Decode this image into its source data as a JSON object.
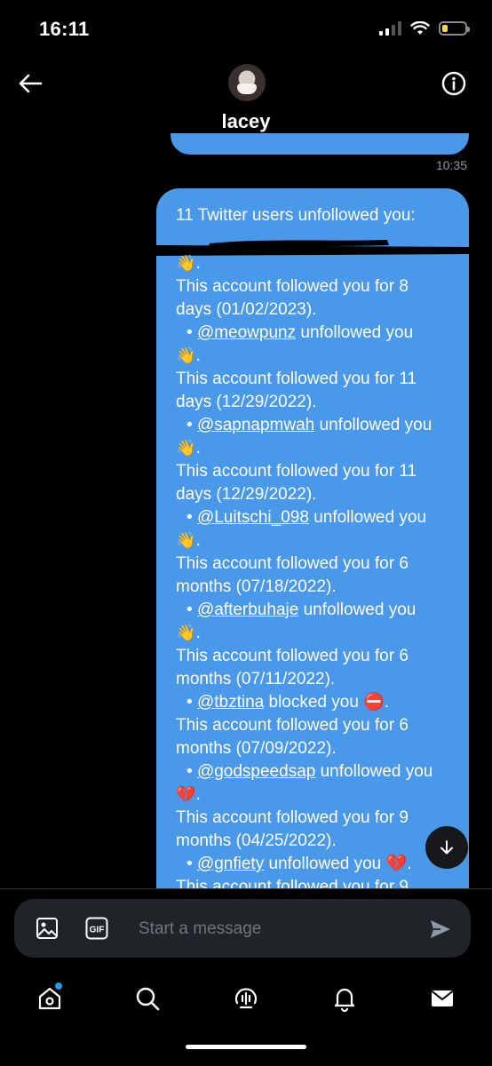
{
  "status": {
    "time": "16:11",
    "battery_level": 0.25,
    "battery_color": "#f7d74a"
  },
  "header": {
    "contact_name": "lacey",
    "back_icon": "arrow-left-icon",
    "info_icon": "info-icon"
  },
  "thread": {
    "previous_timestamp": "10:35",
    "bubble_color": "#4a98e9",
    "message": {
      "heading": "11 Twitter users unfollowed you:",
      "lines": [
        {
          "type": "emoji",
          "text": "👋."
        },
        {
          "type": "text",
          "text": "This account followed you for 8"
        },
        {
          "type": "text",
          "text": "days (01/02/2023)."
        },
        {
          "type": "entry",
          "bullet": "•",
          "handle": "@meowpunz",
          "action": " unfollowed you"
        },
        {
          "type": "emoji",
          "text": "👋."
        },
        {
          "type": "text",
          "text": "This account followed you for 11"
        },
        {
          "type": "text",
          "text": "days (12/29/2022)."
        },
        {
          "type": "entry",
          "bullet": "•",
          "handle": "@sapnapmwah",
          "action": " unfollowed you"
        },
        {
          "type": "emoji",
          "text": "👋."
        },
        {
          "type": "text",
          "text": "This account followed you for 11"
        },
        {
          "type": "text",
          "text": "days (12/29/2022)."
        },
        {
          "type": "entry",
          "bullet": "•",
          "handle": "@Luitschi_098",
          "action": " unfollowed you"
        },
        {
          "type": "emoji",
          "text": "👋."
        },
        {
          "type": "text",
          "text": "This account followed you for 6"
        },
        {
          "type": "text",
          "text": "months (07/18/2022)."
        },
        {
          "type": "entry",
          "bullet": "•",
          "handle": "@afterbuhaje",
          "action": " unfollowed you"
        },
        {
          "type": "emoji",
          "text": "👋."
        },
        {
          "type": "text",
          "text": "This account followed you for 6"
        },
        {
          "type": "text",
          "text": "months (07/11/2022)."
        },
        {
          "type": "entry",
          "bullet": "•",
          "handle": "@tbztina",
          "action": " blocked you ⛔."
        },
        {
          "type": "text",
          "text": "This account followed you for 6"
        },
        {
          "type": "text",
          "text": "months (07/09/2022)."
        },
        {
          "type": "entry",
          "bullet": "•",
          "handle": "@godspeedsap",
          "action": " unfollowed you"
        },
        {
          "type": "emoji",
          "text": "💔."
        },
        {
          "type": "text",
          "text": "This account followed you for 9"
        },
        {
          "type": "text",
          "text": "months (04/25/2022)."
        },
        {
          "type": "entry",
          "bullet": "•",
          "handle": "@gnfiety",
          "action": " unfollowed you 💔."
        },
        {
          "type": "text",
          "text": "This account followed you for 9"
        }
      ]
    }
  },
  "composer": {
    "placeholder": "Start a message",
    "image_icon": "image-icon",
    "gif_icon": "gif-icon",
    "gif_label": "GIF",
    "send_icon": "send-icon"
  },
  "nav": {
    "items": [
      {
        "name": "home",
        "icon": "home-icon",
        "has_dot": true
      },
      {
        "name": "search",
        "icon": "search-icon"
      },
      {
        "name": "spaces",
        "icon": "spaces-icon"
      },
      {
        "name": "notifications",
        "icon": "bell-icon"
      },
      {
        "name": "messages",
        "icon": "mail-icon"
      }
    ],
    "dot_color": "#1d9bf0"
  }
}
